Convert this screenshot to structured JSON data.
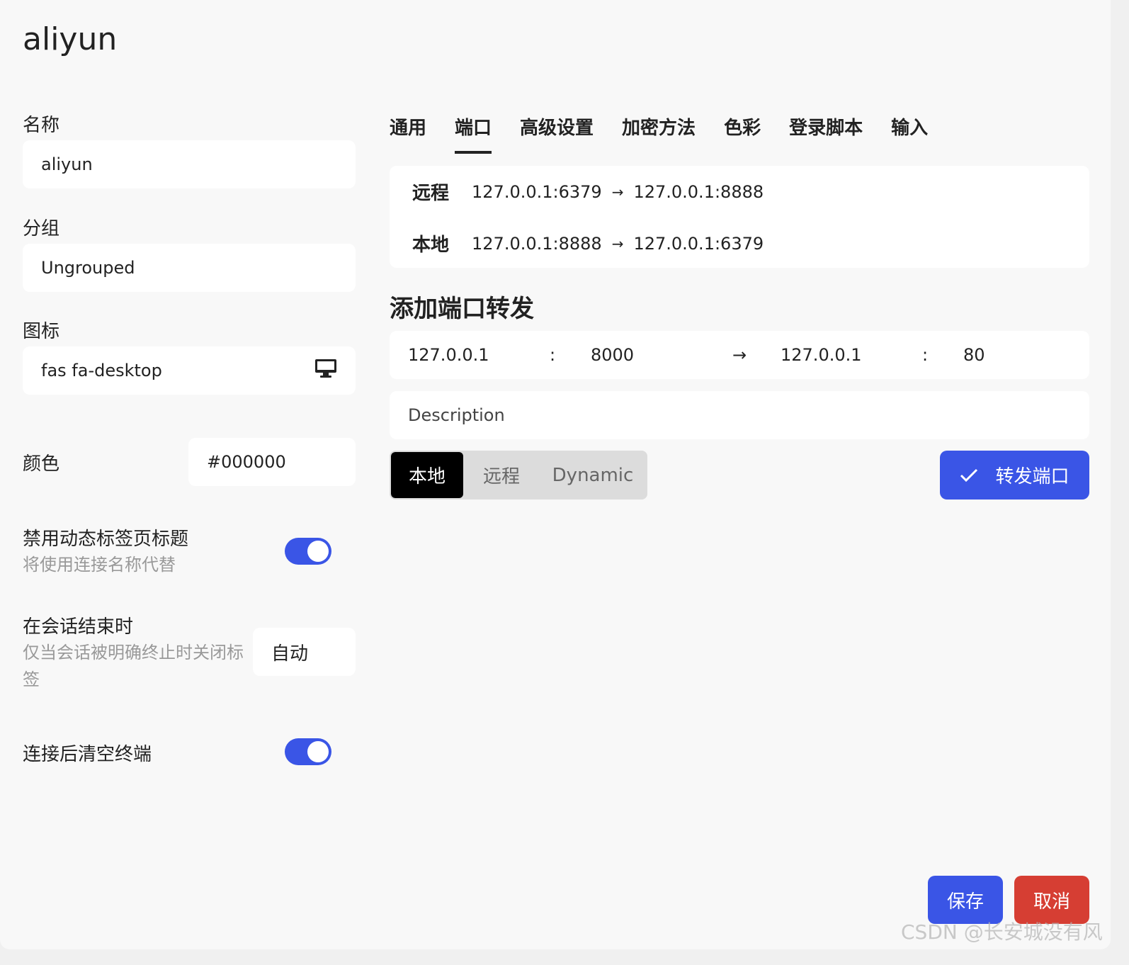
{
  "dialog": {
    "title": "aliyun"
  },
  "left": {
    "name_label": "名称",
    "name_value": "aliyun",
    "group_label": "分组",
    "group_value": "Ungrouped",
    "icon_label": "图标",
    "icon_value": "fas fa-desktop",
    "color_label": "颜色",
    "color_value": "#000000",
    "disable_dynamic_title_label": "禁用动态标签页标题",
    "disable_dynamic_title_sub": "将使用连接名称代替",
    "disable_dynamic_title_on": true,
    "session_end_label": "在会话结束时",
    "session_end_sub": "仅当会话被明确终止时关闭标签",
    "session_end_value": "自动",
    "clear_terminal_label": "连接后清空终端",
    "clear_terminal_on": true
  },
  "tabs": [
    {
      "label": "通用",
      "active": false
    },
    {
      "label": "端口",
      "active": true
    },
    {
      "label": "高级设置",
      "active": false
    },
    {
      "label": "加密方法",
      "active": false
    },
    {
      "label": "色彩",
      "active": false
    },
    {
      "label": "登录脚本",
      "active": false
    },
    {
      "label": "输入",
      "active": false
    }
  ],
  "forwards": [
    {
      "type": "远程",
      "from": "127.0.0.1:6379",
      "to": "127.0.0.1:8888"
    },
    {
      "type": "本地",
      "from": "127.0.0.1:8888",
      "to": "127.0.0.1:6379"
    }
  ],
  "add_forward": {
    "title": "添加端口转发",
    "local_host": "127.0.0.1",
    "sep": ":",
    "local_port": "8000",
    "arrow": "→",
    "remote_host": "127.0.0.1",
    "remote_port": "80",
    "description_placeholder": "Description",
    "modes": [
      "本地",
      "远程",
      "Dynamic"
    ],
    "selected_mode": "本地",
    "submit_label": "转发端口"
  },
  "footer": {
    "save_label": "保存",
    "cancel_label": "取消"
  },
  "watermark": "CSDN @长安城没有风",
  "colors": {
    "accent": "#3a55e6",
    "danger": "#d63e33"
  }
}
